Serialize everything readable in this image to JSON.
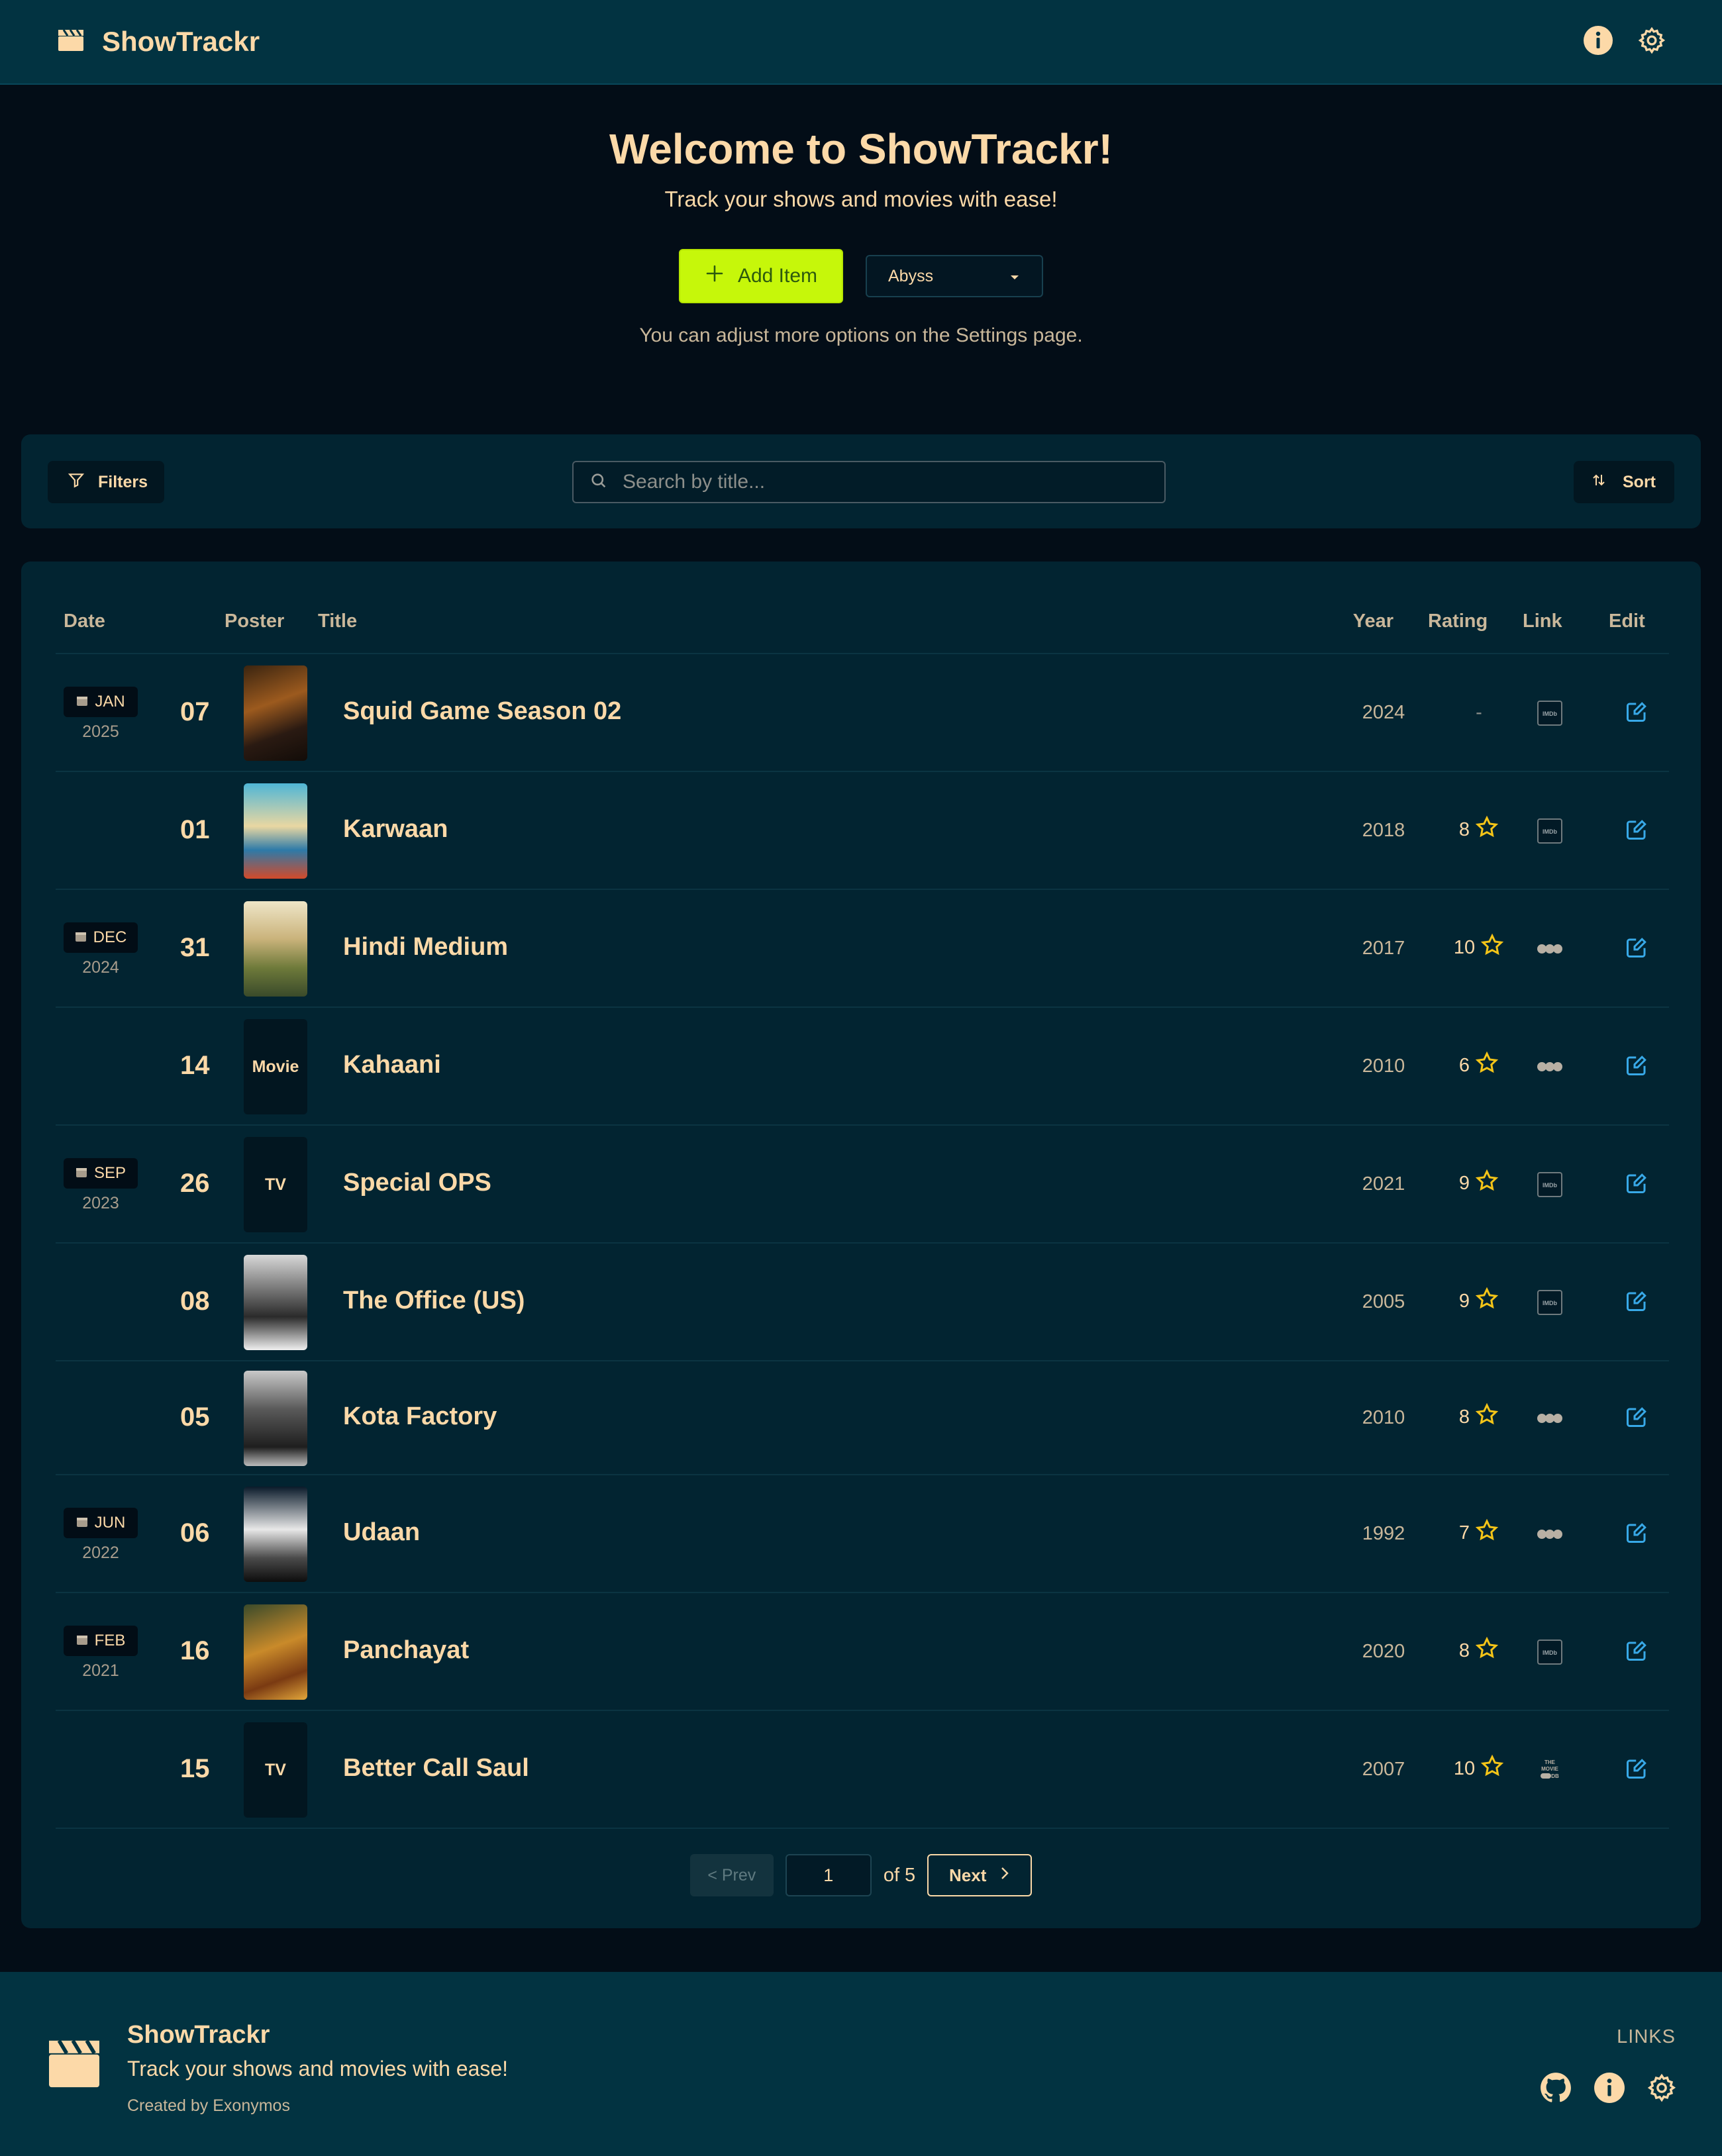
{
  "navbar": {
    "brand": "ShowTrackr",
    "icons": [
      "clapperboard-icon",
      "info-icon",
      "gear-icon"
    ]
  },
  "hero": {
    "title": "Welcome to ShowTrackr!",
    "subtitle": "Track your shows and movies with ease!",
    "add_label": "Add Item",
    "theme_value": "Abyss",
    "note": "You can adjust more options on the Settings page."
  },
  "toolbar": {
    "filters_label": "Filters",
    "search_placeholder": "Search by title...",
    "sort_label": "Sort"
  },
  "table": {
    "headers": {
      "date": "Date",
      "poster": "Poster",
      "title": "Title",
      "year": "Year",
      "rating": "Rating",
      "link": "Link",
      "edit": "Edit"
    },
    "rows": [
      {
        "month": "JAN",
        "year_group": "2025",
        "day": "07",
        "poster": "image",
        "poster_text": "",
        "title": "Squid Game Season 02",
        "year": "2024",
        "rating": "-",
        "link": "imdb"
      },
      {
        "month": "",
        "year_group": "",
        "day": "01",
        "poster": "image",
        "poster_text": "",
        "title": "Karwaan",
        "year": "2018",
        "rating": "8",
        "link": "imdb"
      },
      {
        "month": "DEC",
        "year_group": "2024",
        "day": "31",
        "poster": "image",
        "poster_text": "",
        "title": "Hindi Medium",
        "year": "2017",
        "rating": "10",
        "link": "letterboxd"
      },
      {
        "month": "",
        "year_group": "",
        "day": "14",
        "poster": "placeholder",
        "poster_text": "Movie",
        "title": "Kahaani",
        "year": "2010",
        "rating": "6",
        "link": "letterboxd"
      },
      {
        "month": "SEP",
        "year_group": "2023",
        "day": "26",
        "poster": "placeholder",
        "poster_text": "TV",
        "title": "Special OPS",
        "year": "2021",
        "rating": "9",
        "link": "imdb"
      },
      {
        "month": "",
        "year_group": "",
        "day": "08",
        "poster": "image",
        "poster_text": "",
        "title": "The Office (US)",
        "year": "2005",
        "rating": "9",
        "link": "imdb"
      },
      {
        "month": "",
        "year_group": "",
        "day": "05",
        "poster": "image",
        "poster_text": "",
        "title": "Kota Factory",
        "year": "2010",
        "rating": "8",
        "link": "letterboxd"
      },
      {
        "month": "JUN",
        "year_group": "2022",
        "day": "06",
        "poster": "image",
        "poster_text": "",
        "title": "Udaan",
        "year": "1992",
        "rating": "7",
        "link": "letterboxd"
      },
      {
        "month": "FEB",
        "year_group": "2021",
        "day": "16",
        "poster": "image",
        "poster_text": "",
        "title": "Panchayat",
        "year": "2020",
        "rating": "8",
        "link": "imdb"
      },
      {
        "month": "",
        "year_group": "",
        "day": "15",
        "poster": "placeholder",
        "poster_text": "TV",
        "title": "Better Call Saul",
        "year": "2007",
        "rating": "10",
        "link": "tmdb"
      }
    ]
  },
  "pagination": {
    "prev_label": "< Prev",
    "page_value": "1",
    "of_text": "of 5",
    "next_label": "Next"
  },
  "footer": {
    "name": "ShowTrackr",
    "tagline": "Track your shows and movies with ease!",
    "credit": "Created by Exonymos",
    "links_label": "LINKS"
  },
  "colors": {
    "background": "#030d17",
    "navbar": "#023341",
    "card": "#022431",
    "accent": "#c6f70a",
    "text": "#fcd9a8",
    "star": "#f5c518",
    "edit": "#38a9e8"
  }
}
